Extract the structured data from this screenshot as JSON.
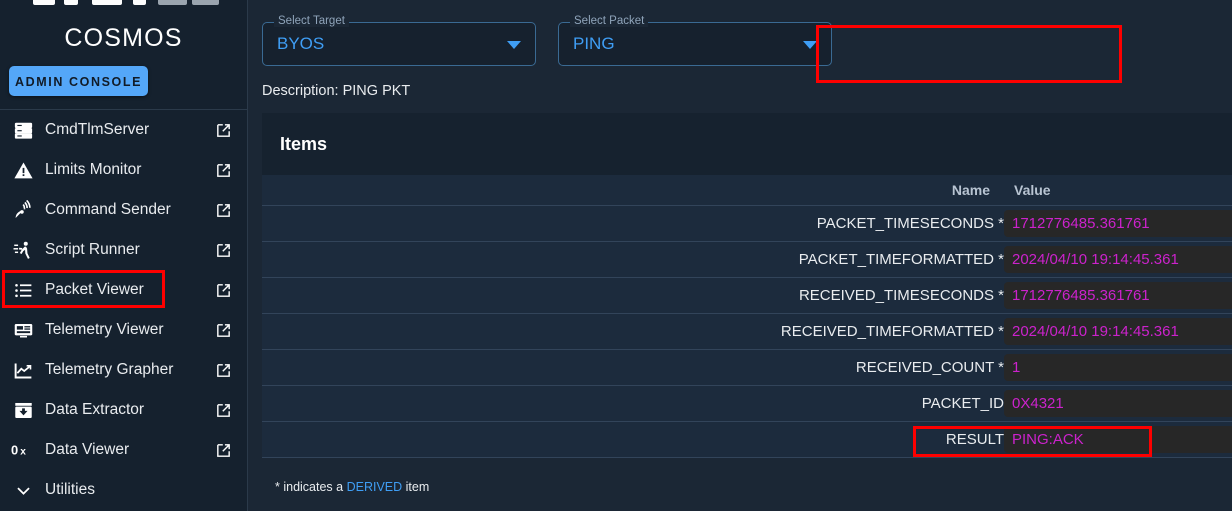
{
  "sidebar": {
    "brand": "COSMOS",
    "admin_button": "ADMIN CONSOLE",
    "items": [
      {
        "label": "CmdTlmServer",
        "icon": "server-icon",
        "external": "open-in-new-icon"
      },
      {
        "label": "Limits Monitor",
        "icon": "warning-triangle-icon",
        "external": "open-in-new-icon"
      },
      {
        "label": "Command Sender",
        "icon": "satellite-dish-icon",
        "external": "open-in-new-icon"
      },
      {
        "label": "Script Runner",
        "icon": "script-runner-icon",
        "external": "open-in-new-icon"
      },
      {
        "label": "Packet Viewer",
        "icon": "list-icon",
        "external": "open-in-new-icon"
      },
      {
        "label": "Telemetry Viewer",
        "icon": "monitor-icon",
        "external": "open-in-new-icon"
      },
      {
        "label": "Telemetry Grapher",
        "icon": "chart-line-icon",
        "external": "open-in-new-icon"
      },
      {
        "label": "Data Extractor",
        "icon": "download-box-icon",
        "external": "open-in-new-icon"
      },
      {
        "label": "Data Viewer",
        "icon": "hex-0x-icon",
        "external": "open-in-new-icon"
      }
    ],
    "utilities": {
      "label": "Utilities",
      "icon": "chevron-down-icon"
    }
  },
  "selectors": {
    "target": {
      "legend": "Select Target",
      "value": "BYOS",
      "caret": "chevron-down-icon"
    },
    "packet": {
      "legend": "Select Packet",
      "value": "PING",
      "caret": "chevron-down-icon"
    },
    "description": "Description: PING PKT"
  },
  "items_card": {
    "title": "Items",
    "columns": [
      "Name",
      "Value"
    ],
    "rows": [
      {
        "name": "PACKET_TIMESECONDS *",
        "value": "1712776485.361761"
      },
      {
        "name": "PACKET_TIMEFORMATTED *",
        "value": "2024/04/10 19:14:45.361"
      },
      {
        "name": "RECEIVED_TIMESECONDS *",
        "value": "1712776485.361761"
      },
      {
        "name": "RECEIVED_TIMEFORMATTED *",
        "value": "2024/04/10 19:14:45.361"
      },
      {
        "name": "RECEIVED_COUNT *",
        "value": "1"
      },
      {
        "name": "PACKET_ID",
        "value": "0X4321"
      },
      {
        "name": "RESULT",
        "value": "PING:ACK"
      }
    ],
    "footnote_prefix": "* indicates a ",
    "footnote_link": "DERIVED",
    "footnote_suffix": " item"
  },
  "colors": {
    "accent_blue": "#3f9ef5",
    "admin_button": "#54a7f8",
    "value_magenta": "#cc22cc",
    "annotation_red": "#fe0000",
    "sidebar_bg": "#15212e",
    "main_bg": "#1b2735",
    "row_bg": "#1c2b3d"
  }
}
